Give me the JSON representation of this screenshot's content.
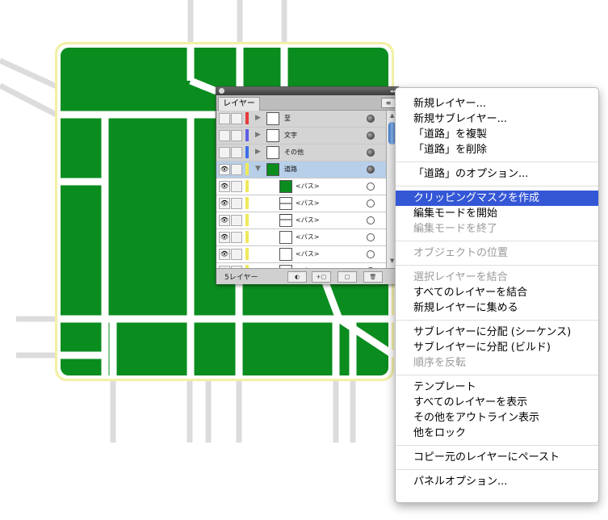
{
  "canvas": {
    "colors": {
      "fill": "#0a8c1f",
      "road": "#ffffff",
      "outline": "#f2f0a6",
      "street": "#dcdcdc"
    }
  },
  "layers_panel": {
    "tab_label": "レイヤー",
    "layer_count": "5レイヤー",
    "menu_button_icon": "panel-menu-icon",
    "layers": [
      {
        "name": "至",
        "color": "#e83a3a",
        "expanded": false,
        "selected": false,
        "eye": false
      },
      {
        "name": "文字",
        "color": "#5d5de6",
        "expanded": false,
        "selected": false,
        "eye": false
      },
      {
        "name": "その他",
        "color": "#3b6ee8",
        "expanded": false,
        "selected": false,
        "eye": false
      },
      {
        "name": "道路",
        "color": "#f0e85a",
        "expanded": true,
        "selected": true,
        "eye": true
      }
    ],
    "sublayers": [
      {
        "name": "<パス>",
        "thumb": "green"
      },
      {
        "name": "<パス>",
        "thumb": "line-h"
      },
      {
        "name": "<パス>",
        "thumb": "line-corner"
      },
      {
        "name": "<パス>",
        "thumb": "blank"
      },
      {
        "name": "<パス>",
        "thumb": "blank"
      },
      {
        "name": "<パス>",
        "thumb": "blank"
      }
    ],
    "footer_buttons": [
      "make-clip-icon",
      "new-sublayer-icon",
      "new-layer-icon",
      "trash-icon"
    ]
  },
  "context_menu": {
    "items": [
      {
        "label": "新規レイヤー...",
        "state": "normal"
      },
      {
        "label": "新規サブレイヤー...",
        "state": "normal"
      },
      {
        "label": "「道路」を複製",
        "state": "normal"
      },
      {
        "label": "「道路」を削除",
        "state": "normal"
      },
      {
        "separator": true
      },
      {
        "label": "「道路」のオプション...",
        "state": "normal"
      },
      {
        "separator": true
      },
      {
        "label": "クリッピングマスクを作成",
        "state": "highlighted"
      },
      {
        "label": "編集モードを開始",
        "state": "normal"
      },
      {
        "label": "編集モードを終了",
        "state": "disabled"
      },
      {
        "separator": true
      },
      {
        "label": "オブジェクトの位置",
        "state": "disabled"
      },
      {
        "separator": true
      },
      {
        "label": "選択レイヤーを結合",
        "state": "disabled"
      },
      {
        "label": "すべてのレイヤーを結合",
        "state": "normal"
      },
      {
        "label": "新規レイヤーに集める",
        "state": "normal"
      },
      {
        "separator": true
      },
      {
        "label": "サブレイヤーに分配 (シーケンス)",
        "state": "normal"
      },
      {
        "label": "サブレイヤーに分配 (ビルド)",
        "state": "normal"
      },
      {
        "label": "順序を反転",
        "state": "disabled"
      },
      {
        "separator": true
      },
      {
        "label": "テンプレート",
        "state": "normal"
      },
      {
        "label": "すべてのレイヤーを表示",
        "state": "normal"
      },
      {
        "label": "その他をアウトライン表示",
        "state": "normal"
      },
      {
        "label": "他をロック",
        "state": "normal"
      },
      {
        "separator": true
      },
      {
        "label": "コピー元のレイヤーにペースト",
        "state": "normal"
      },
      {
        "separator": true
      },
      {
        "label": "パネルオプション...",
        "state": "normal"
      }
    ]
  }
}
